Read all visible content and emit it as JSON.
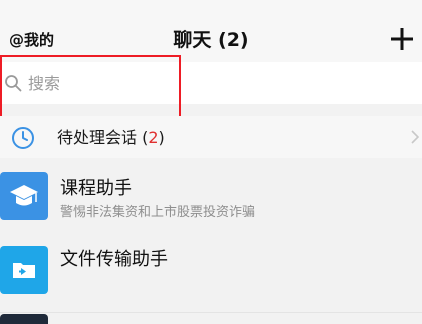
{
  "header": {
    "left_label": "@我的",
    "title": "聊天 (2)",
    "add_icon": "plus-icon"
  },
  "search": {
    "placeholder": "搜索",
    "icon": "search-icon"
  },
  "pending": {
    "icon": "clock-icon",
    "label": "待处理会话",
    "count": "2"
  },
  "chats": [
    {
      "name": "课程助手",
      "preview": "警惕非法集资和上市股票投资诈骗",
      "icon": "graduation-cap-icon"
    },
    {
      "name": "文件传输助手",
      "preview": "",
      "icon": "folder-transfer-icon"
    }
  ],
  "colors": {
    "accent": "#3b92e4",
    "highlight_border": "#ee1c25",
    "count": "#e03030"
  }
}
